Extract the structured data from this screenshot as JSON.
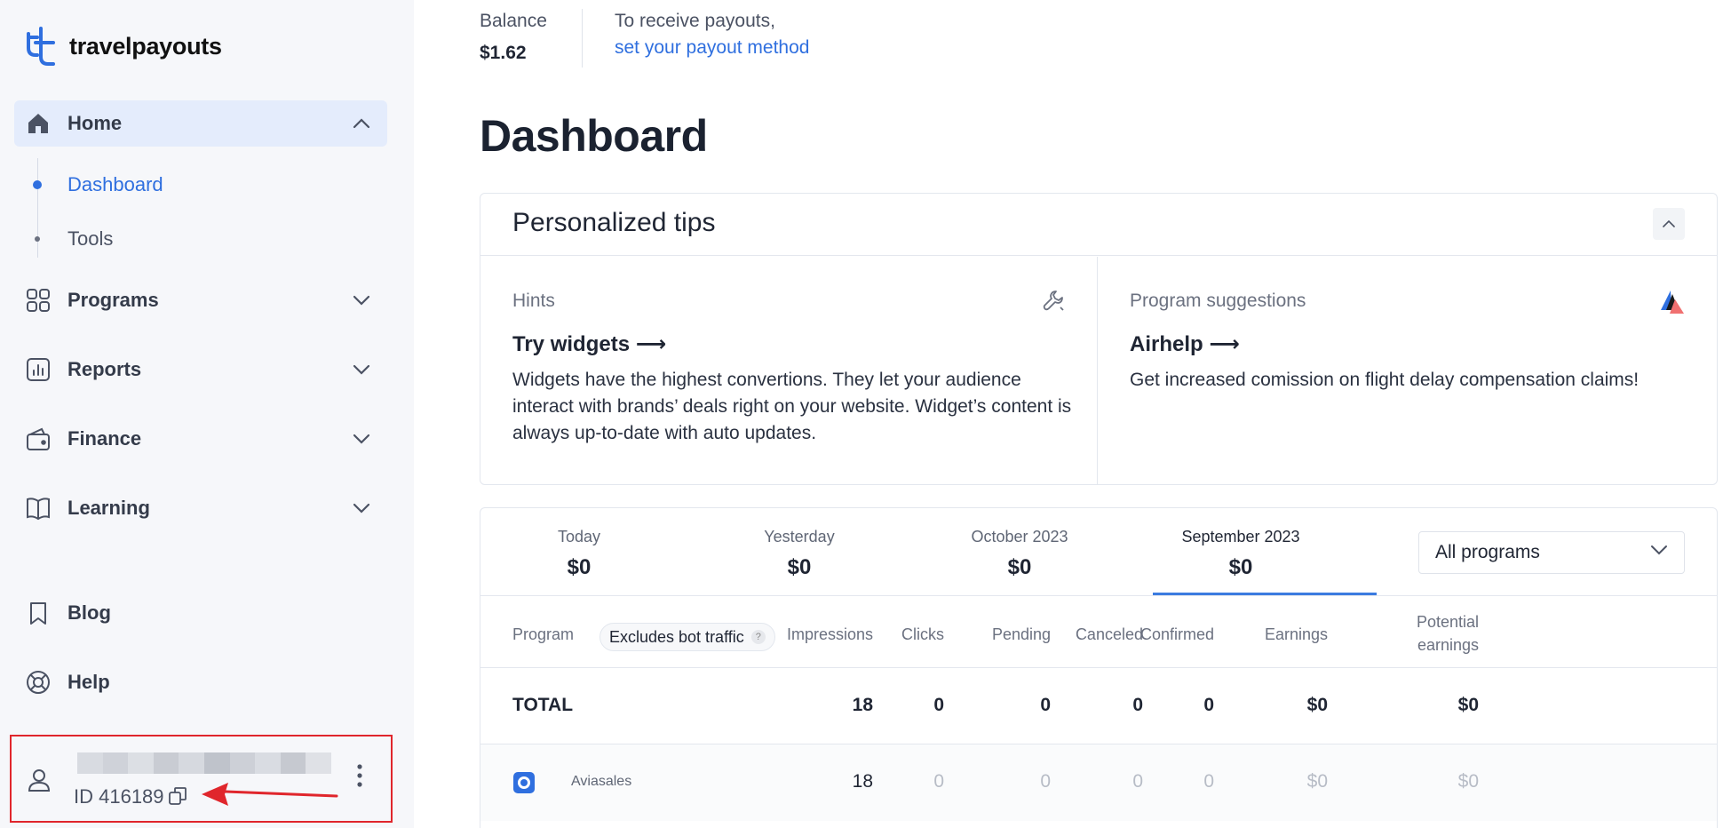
{
  "brand": {
    "name": "travelpayouts",
    "color": "#2f6fdf"
  },
  "sidebar": {
    "home": {
      "label": "Home",
      "sub": [
        {
          "label": "Dashboard"
        },
        {
          "label": "Tools"
        }
      ]
    },
    "items": [
      {
        "label": "Programs",
        "icon": "grid-icon"
      },
      {
        "label": "Reports",
        "icon": "chart-icon"
      },
      {
        "label": "Finance",
        "icon": "wallet-icon"
      },
      {
        "label": "Learning",
        "icon": "book-icon"
      }
    ],
    "blog": {
      "label": "Blog",
      "icon": "bookmark-icon"
    },
    "help": {
      "label": "Help",
      "icon": "lifebuoy-icon"
    },
    "account": {
      "id": "ID 416189"
    }
  },
  "header": {
    "balance_label": "Balance",
    "balance_value": "$1.62",
    "payout_text": "To receive payouts,",
    "payout_link": "set your payout method"
  },
  "page": {
    "title": "Dashboard"
  },
  "tips": {
    "title": "Personalized tips",
    "hints": {
      "category": "Hints",
      "heading": "Try widgets ⟶",
      "body": "Widgets have the highest convertions. They let your audience interact with brands’ deals right on your website. Widget’s content is always up-to-date with auto updates."
    },
    "suggestions": {
      "category": "Program suggestions",
      "heading": "Airhelp ⟶",
      "body": "Get increased comission on flight delay compensation claims!"
    }
  },
  "stats": {
    "periods": [
      {
        "label": "Today",
        "value": "$0"
      },
      {
        "label": "Yesterday",
        "value": "$0"
      },
      {
        "label": "October 2023",
        "value": "$0"
      },
      {
        "label": "September 2023",
        "value": "$0"
      }
    ],
    "filter": "All programs",
    "columns": {
      "program": "Program",
      "badge": "Excludes bot traffic",
      "badge_help": "?",
      "impressions": "Impressions",
      "clicks": "Clicks",
      "pending": "Pending",
      "canceled": "Canceled",
      "confirmed": "Confirmed",
      "earnings": "Earnings",
      "potential_1": "Potential",
      "potential_2": "earnings"
    },
    "total": {
      "label": "TOTAL",
      "impressions": "18",
      "clicks": "0",
      "pending": "0",
      "canceled": "0",
      "confirmed": "0",
      "earnings": "$0",
      "potential": "$0"
    },
    "program_row": {
      "name": "Aviasales",
      "impressions": "18",
      "clicks": "0",
      "pending": "0",
      "canceled": "0",
      "confirmed": "0",
      "earnings": "$0",
      "potential": "$0"
    }
  }
}
